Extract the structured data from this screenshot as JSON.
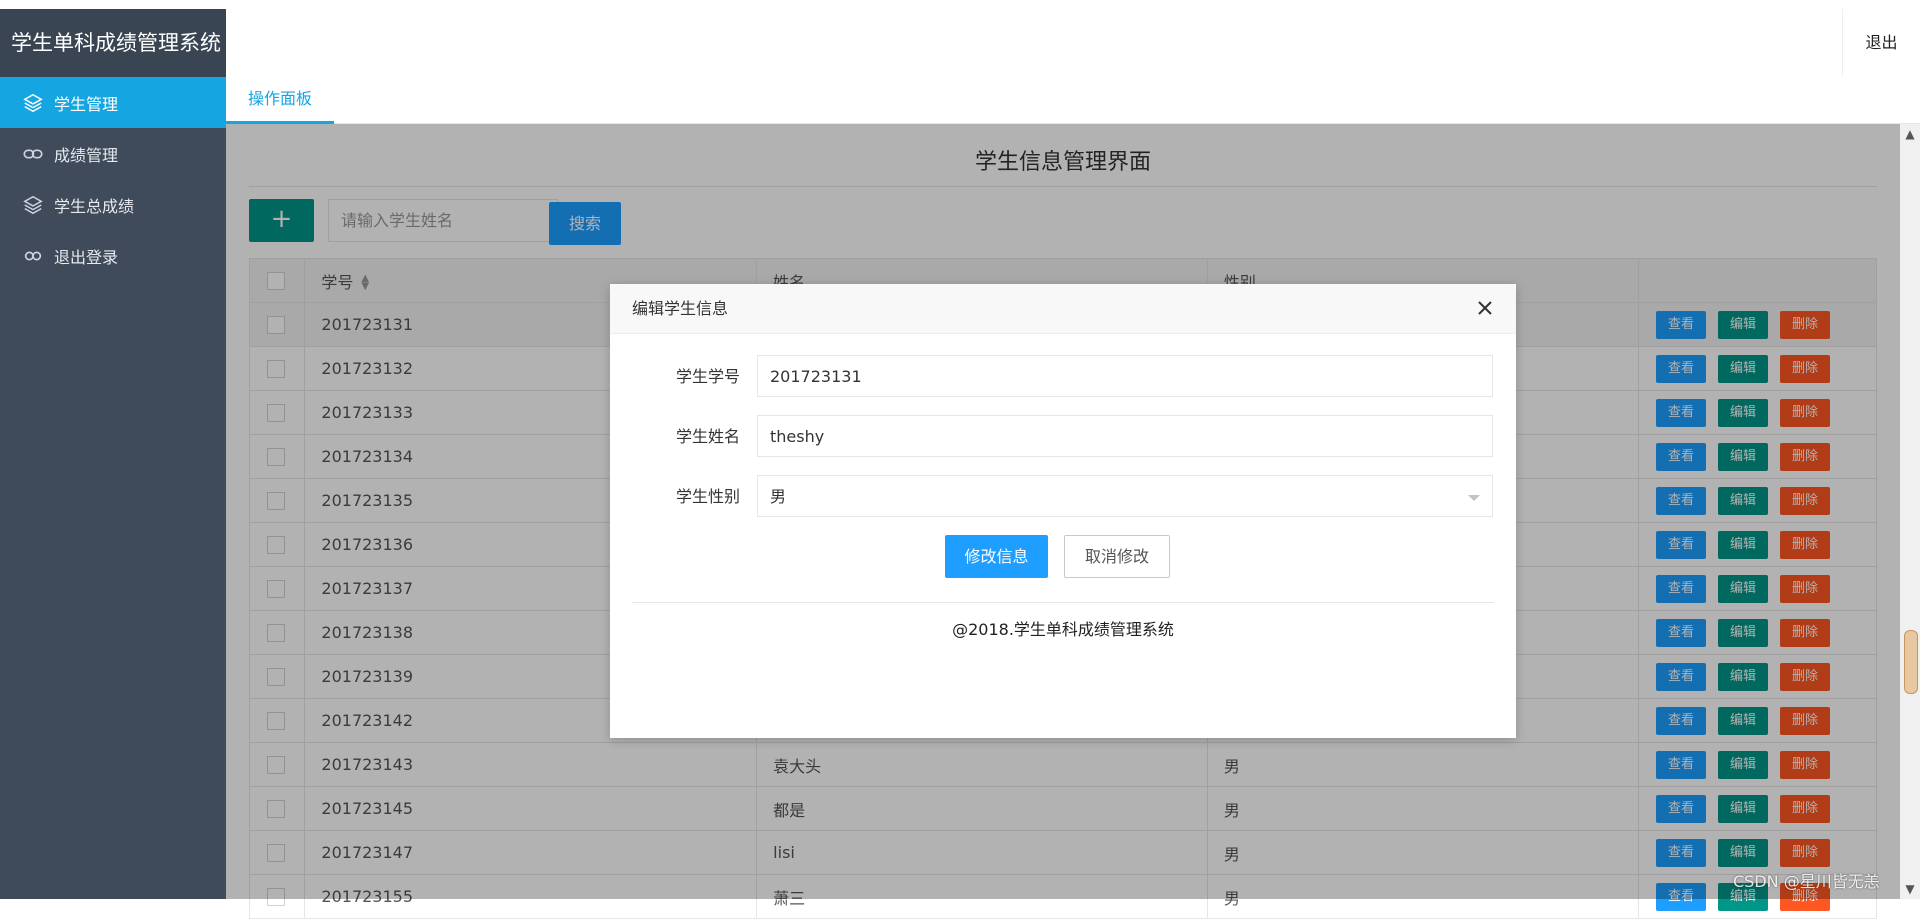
{
  "app": {
    "title": "学生单科成绩管理系统"
  },
  "sidebar": {
    "items": [
      {
        "label": "学生管理",
        "icon": "layers-icon",
        "active": true
      },
      {
        "label": "成绩管理",
        "icon": "link-icon",
        "active": false
      },
      {
        "label": "学生总成绩",
        "icon": "layers-icon",
        "active": false
      },
      {
        "label": "退出登录",
        "icon": "logout-link-icon",
        "active": false
      }
    ]
  },
  "header": {
    "logout_label": "退出"
  },
  "tabs": [
    {
      "label": "操作面板",
      "active": true
    }
  ],
  "main": {
    "title": "学生信息管理界面",
    "add_label": "+",
    "search_placeholder": "请输入学生姓名",
    "search_label": "搜索"
  },
  "table": {
    "columns": [
      "学号",
      "姓名",
      "性别"
    ],
    "actions": {
      "view": "查看",
      "edit": "编辑",
      "delete": "删除"
    },
    "rows": [
      {
        "id": "201723131",
        "name": "",
        "sex": ""
      },
      {
        "id": "201723132",
        "name": "",
        "sex": ""
      },
      {
        "id": "201723133",
        "name": "",
        "sex": ""
      },
      {
        "id": "201723134",
        "name": "",
        "sex": ""
      },
      {
        "id": "201723135",
        "name": "",
        "sex": ""
      },
      {
        "id": "201723136",
        "name": "",
        "sex": ""
      },
      {
        "id": "201723137",
        "name": "",
        "sex": ""
      },
      {
        "id": "201723138",
        "name": "",
        "sex": ""
      },
      {
        "id": "201723139",
        "name": "",
        "sex": ""
      },
      {
        "id": "201723142",
        "name": "",
        "sex": ""
      },
      {
        "id": "201723143",
        "name": "袁大头",
        "sex": "男"
      },
      {
        "id": "201723145",
        "name": "都是",
        "sex": "男"
      },
      {
        "id": "201723147",
        "name": "lisi",
        "sex": "男"
      },
      {
        "id": "201723155",
        "name": "萧三",
        "sex": "男"
      }
    ]
  },
  "modal": {
    "title": "编辑学生信息",
    "fields": {
      "id_label": "学生学号",
      "id_value": "201723131",
      "name_label": "学生姓名",
      "name_value": "theshy",
      "sex_label": "学生性别",
      "sex_value": "男"
    },
    "submit_label": "修改信息",
    "cancel_label": "取消修改",
    "footer": "@2018.学生单科成绩管理系统"
  },
  "watermark": "CSDN @星川皆无恙",
  "colors": {
    "sidebar_bg": "#3f4b5b",
    "accent": "#15a6e1",
    "primary": "#1e9fff",
    "edit": "#009688",
    "danger": "#ff5722"
  }
}
